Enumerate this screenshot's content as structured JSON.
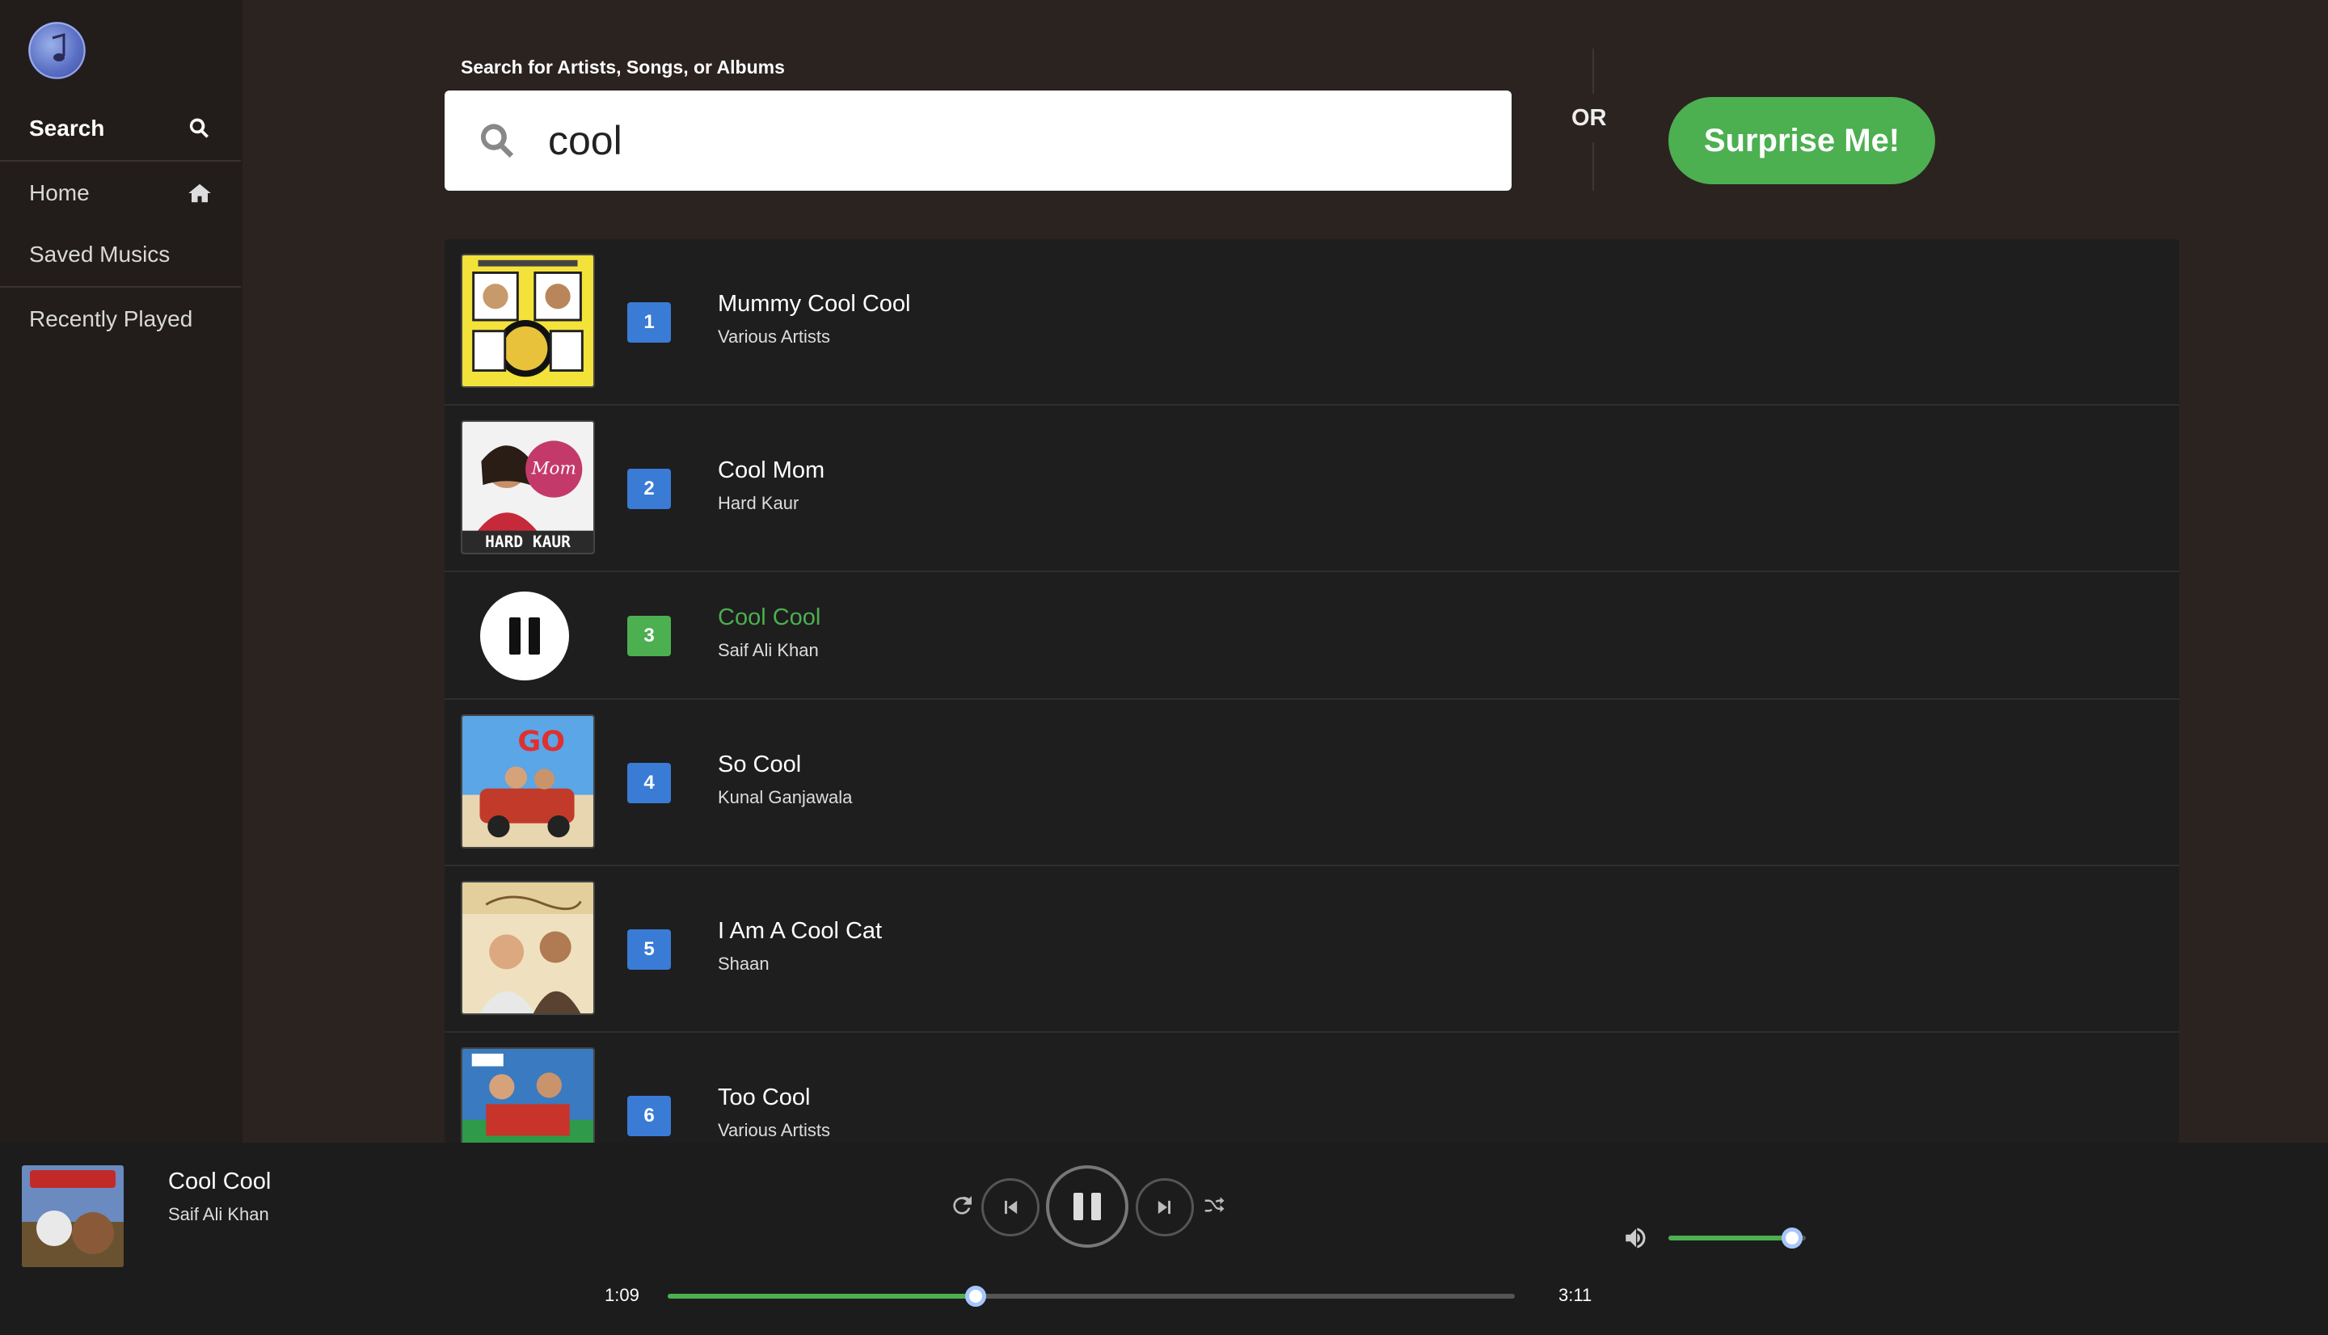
{
  "sidebar": {
    "items": [
      {
        "label": "Search",
        "icon": "search-icon",
        "active": true
      },
      {
        "label": "Home",
        "icon": "home-icon",
        "active": false
      },
      {
        "label": "Saved Musics",
        "icon": "",
        "active": false
      },
      {
        "label": "Recently Played",
        "icon": "",
        "active": false
      }
    ]
  },
  "search": {
    "label": "Search for Artists, Songs, or Albums",
    "value": "cool",
    "or_text": "OR",
    "surprise_label": "Surprise Me!"
  },
  "results": [
    {
      "number": "1",
      "title": "Mummy Cool Cool",
      "artist": "Various Artists",
      "playing": false
    },
    {
      "number": "2",
      "title": "Cool Mom",
      "artist": "Hard Kaur",
      "playing": false,
      "cover_text": "HARD KAUR"
    },
    {
      "number": "3",
      "title": "Cool Cool",
      "artist": "Saif Ali Khan",
      "playing": true
    },
    {
      "number": "4",
      "title": "So Cool",
      "artist": "Kunal Ganjawala",
      "playing": false
    },
    {
      "number": "5",
      "title": "I Am A Cool Cat",
      "artist": "Shaan",
      "playing": false
    },
    {
      "number": "6",
      "title": "Too Cool",
      "artist": "Various Artists",
      "playing": false
    }
  ],
  "player": {
    "title": "Cool Cool",
    "artist": "Saif Ali Khan",
    "current_time": "1:09",
    "total_time": "3:11",
    "progress": 0.364,
    "volume": 0.9
  },
  "colors": {
    "accent": "#4caf50",
    "number_badge": "#3a7bd5",
    "background": "#2b2320",
    "sidebar": "#221c1a",
    "list": "#1e1e1e"
  }
}
